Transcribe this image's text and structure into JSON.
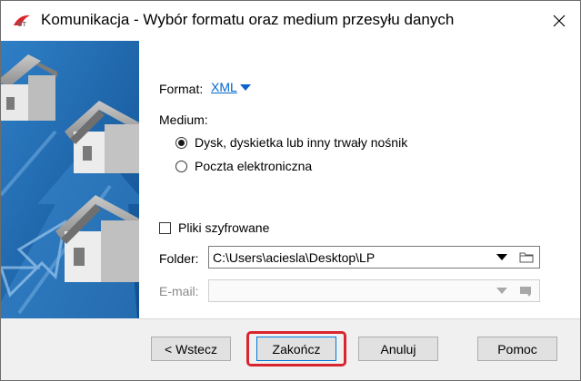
{
  "window": {
    "title": "Komunikacja - Wybór formatu oraz medium przesyłu danych",
    "app_icon": "gt-logo-icon",
    "close_icon": "close-icon"
  },
  "form": {
    "format_label": "Format:",
    "format_value": "XML",
    "medium_label": "Medium:",
    "medium_options": [
      {
        "label": "Dysk, dyskietka lub inny trwały nośnik",
        "selected": true
      },
      {
        "label": "Poczta elektroniczna",
        "selected": false
      }
    ],
    "encrypted_label": "Pliki szyfrowane",
    "encrypted_checked": false,
    "folder_label": "Folder:",
    "folder_value": "C:\\Users\\aciesla\\Desktop\\LP",
    "email_label": "E-mail:",
    "email_value": ""
  },
  "buttons": {
    "back": "< Wstecz",
    "finish": "Zakończ",
    "cancel": "Anuluj",
    "help": "Pomoc"
  },
  "colors": {
    "link": "#0066cc",
    "highlight": "#d9252e",
    "side_panel": "#1f5fa5"
  }
}
